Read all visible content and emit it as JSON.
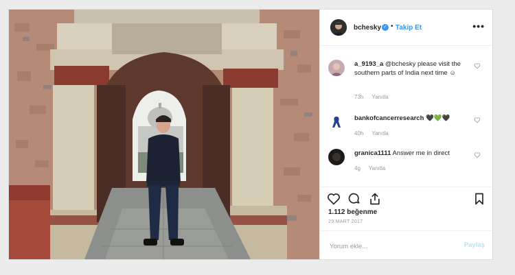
{
  "post": {
    "photo_icon": "photo-of-man-in-stone-gateway"
  },
  "header": {
    "username": "bchesky",
    "separator": "•",
    "follow_label": "Takip Et",
    "more_label": "•••"
  },
  "comments": [
    {
      "username": "a_9193_a",
      "text": " @bchesky please visit the southern parts of India next time ☺",
      "age": "73h",
      "reply_label": "Yanıtla"
    },
    {
      "username": "bankofcancerresearch",
      "text": " 🖤💚🖤",
      "age": "40h",
      "reply_label": "Yanıtla"
    },
    {
      "username": "granica1111",
      "text": " Answer me in direct",
      "age": "4g",
      "reply_label": "Yanıtla"
    }
  ],
  "likes_label": "1.112 beğenme",
  "date_label": "29 MART 2017",
  "add_comment": {
    "placeholder": "Yorum ekle...",
    "share_label": "Paylaş"
  },
  "colors": {
    "link": "#3897f0",
    "muted": "#999999",
    "share_disabled": "#b2dffc"
  }
}
